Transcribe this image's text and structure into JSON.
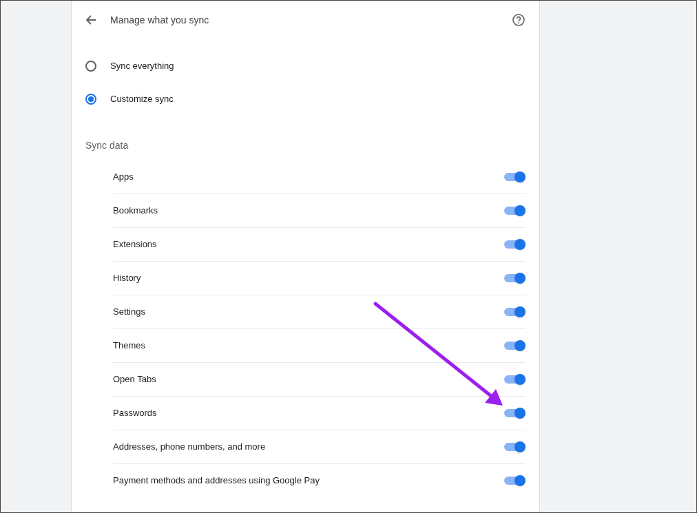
{
  "header": {
    "title": "Manage what you sync"
  },
  "sync_options": [
    {
      "label": "Sync everything",
      "selected": false
    },
    {
      "label": "Customize sync",
      "selected": true
    }
  ],
  "section_title": "Sync data",
  "items": [
    {
      "label": "Apps",
      "on": true
    },
    {
      "label": "Bookmarks",
      "on": true
    },
    {
      "label": "Extensions",
      "on": true
    },
    {
      "label": "History",
      "on": true
    },
    {
      "label": "Settings",
      "on": true
    },
    {
      "label": "Themes",
      "on": true
    },
    {
      "label": "Open Tabs",
      "on": true
    },
    {
      "label": "Passwords",
      "on": true
    },
    {
      "label": "Addresses, phone numbers, and more",
      "on": true
    },
    {
      "label": "Payment methods and addresses using Google Pay",
      "on": true
    }
  ]
}
